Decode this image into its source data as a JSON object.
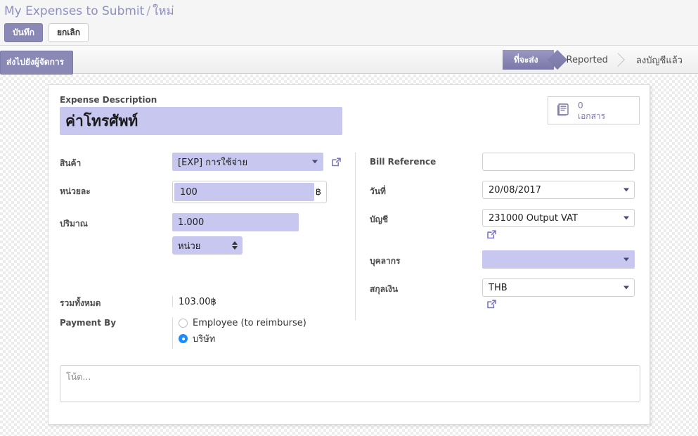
{
  "breadcrumb": {
    "root": "My Expenses to Submit",
    "separator": "/",
    "current": "ใหม่"
  },
  "toolbar": {
    "save_label": "บันทึก",
    "cancel_label": "ยกเลิก"
  },
  "statusrow": {
    "submit_label": "ส่งไปยังผู้จัดการ",
    "stages": [
      {
        "label": "ที่จะส่ง",
        "active": true
      },
      {
        "label": "Reported",
        "active": false
      },
      {
        "label": "ลงบัญชีแล้ว",
        "active": false
      }
    ]
  },
  "sheet": {
    "description": {
      "label": "Expense Description",
      "value": "ค่าโทรศัพท์"
    },
    "documents_button": {
      "icon": "book-icon",
      "count": "0",
      "label": "เอกสาร"
    },
    "left_fields": {
      "product": {
        "label": "สินค้า",
        "value": "[EXP] การใช้จ่าย",
        "has_external_link": true
      },
      "unit_price": {
        "label": "หน่วยละ",
        "value": "100",
        "currency_symbol": "฿"
      },
      "quantity": {
        "label": "ปริมาณ",
        "value": "1.000",
        "uom": "หน่วย"
      }
    },
    "right_fields": {
      "bill_reference": {
        "label": "Bill Reference",
        "value": "",
        "placeholder": ""
      },
      "date": {
        "label": "วันที่",
        "value": "20/08/2017"
      },
      "account": {
        "label": "บัญชี",
        "value": "231000 Output VAT",
        "has_external_link": true
      },
      "employee": {
        "label": "บุคลากร",
        "value": ""
      },
      "currency": {
        "label": "สกุลเงิน",
        "value": "THB",
        "has_external_link": true
      }
    },
    "summary": {
      "total": {
        "label": "รวมทั้งหมด",
        "value": "103.00฿"
      },
      "payment_by": {
        "label": "Payment By",
        "options": [
          {
            "label": "Employee (to reimburse)",
            "selected": false
          },
          {
            "label": "บริษัท",
            "selected": true
          }
        ]
      }
    },
    "notes": {
      "value": "",
      "placeholder": "โน้ต..."
    }
  },
  "colors": {
    "accent_purple": "#8a88b5",
    "field_lavender": "#c7c7f0",
    "radio_blue": "#1a8cff",
    "breadcrumb_text": "#8f8fbd"
  }
}
